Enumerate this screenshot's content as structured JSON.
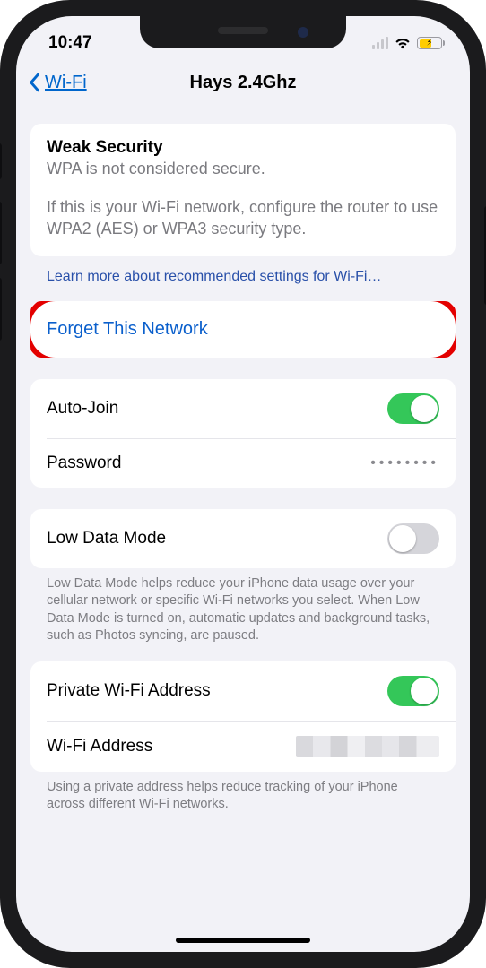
{
  "status": {
    "time": "10:47"
  },
  "nav": {
    "back": "Wi-Fi",
    "title": "Hays 2.4Ghz"
  },
  "security": {
    "heading": "Weak Security",
    "subtitle": "WPA is not considered secure.",
    "body": "If this is your Wi-Fi network, configure the router to use WPA2 (AES) or WPA3 security type.",
    "learn_more": "Learn more about recommended settings for Wi-Fi…"
  },
  "forget": {
    "label": "Forget This Network"
  },
  "auto_join": {
    "label": "Auto-Join",
    "on": true
  },
  "password": {
    "label": "Password",
    "mask": "••••••••"
  },
  "low_data": {
    "label": "Low Data Mode",
    "on": false,
    "footer": "Low Data Mode helps reduce your iPhone data usage over your cellular network or specific Wi-Fi networks you select. When Low Data Mode is turned on, automatic updates and background tasks, such as Photos syncing, are paused."
  },
  "private_addr": {
    "label": "Private Wi-Fi Address",
    "on": true
  },
  "wifi_addr": {
    "label": "Wi-Fi Address"
  },
  "private_footer": "Using a private address helps reduce tracking of your iPhone across different Wi-Fi networks."
}
